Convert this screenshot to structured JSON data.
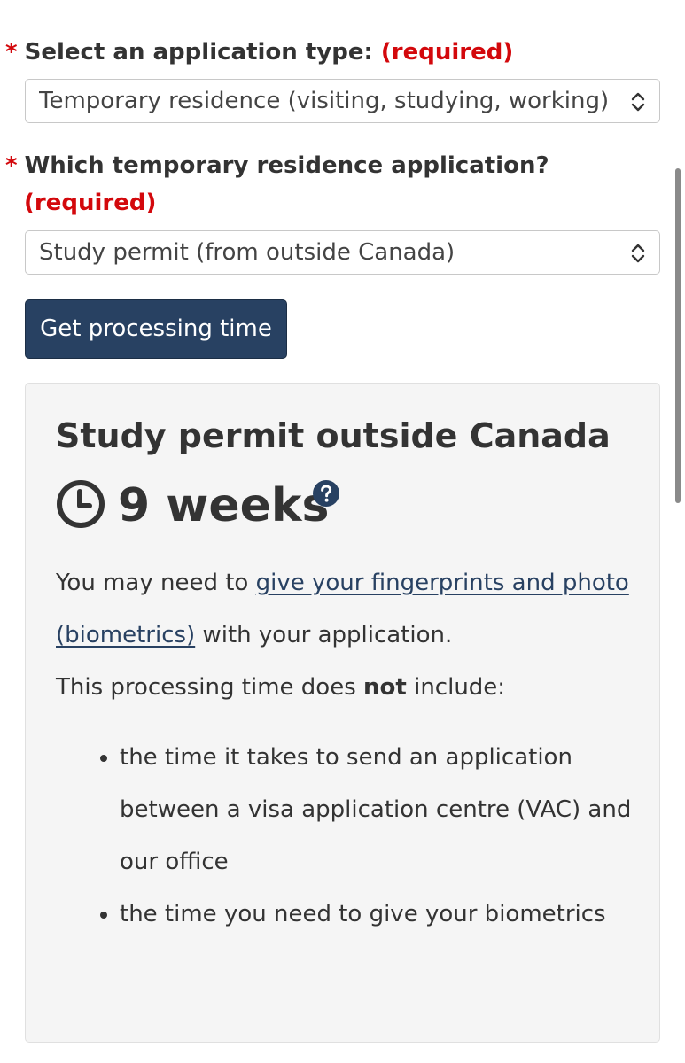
{
  "form": {
    "application_type": {
      "asterisk": "*",
      "label": "Select an application type:",
      "required": "(required)",
      "selected_value": "Temporary residence (visiting, studying, working)"
    },
    "temporary_residence": {
      "asterisk": "*",
      "label": "Which temporary residence application?",
      "required": "(required)",
      "selected_value": "Study permit (from outside Canada)"
    },
    "submit_label": "Get processing time"
  },
  "result": {
    "title": "Study permit outside Canada",
    "processing_time": "9 weeks",
    "intro_prefix": "You may need to ",
    "biometrics_link": "give your fingerprints and photo (biometrics)",
    "intro_suffix": " with your application.",
    "excludes_prefix": "This processing time does ",
    "excludes_emphasis": "not",
    "excludes_suffix": " include:",
    "excluded_items": [
      "the time it takes to send an application between a visa application centre (VAC) and our office",
      "the time you need to give your biometrics"
    ]
  },
  "icons": {
    "clock": "clock-icon",
    "help": "question-circle-icon",
    "select_arrows": "chevron-up-down-icon"
  },
  "colors": {
    "required_red": "#d3080c",
    "button_navy": "#284162",
    "link_blue": "#284162",
    "panel_background": "#f5f5f5"
  }
}
